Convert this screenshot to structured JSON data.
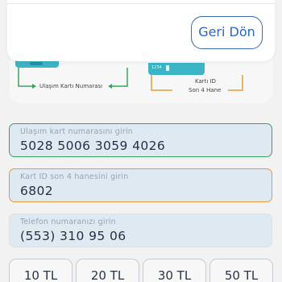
{
  "guide": {
    "card_number_label": "Ulaşım Kartı Numarası",
    "card_id_label_line1": "Kartı ID",
    "card_id_label_line2": "Son 4 Hane",
    "card_id_number": "1234"
  },
  "form": {
    "card_number": {
      "label": "Ulaşım kart numarasını girin",
      "value": "5028 5006 3059 4026"
    },
    "card_id": {
      "label": "Kart ID son 4 hanesini girin",
      "value": "6802"
    },
    "phone": {
      "label": "Telefon numaranızı girin",
      "value": "(553) 310 95 06"
    }
  },
  "amounts": [
    "10 TL",
    "20 TL",
    "30 TL",
    "50 TL"
  ],
  "modal": {
    "back_button_label": "Geri Dön"
  },
  "colors": {
    "card_number_accent": "#3aa35a",
    "card_id_accent": "#e59a3b",
    "button_accent": "#2f66b3",
    "card_blue": "#3bb4c6"
  }
}
